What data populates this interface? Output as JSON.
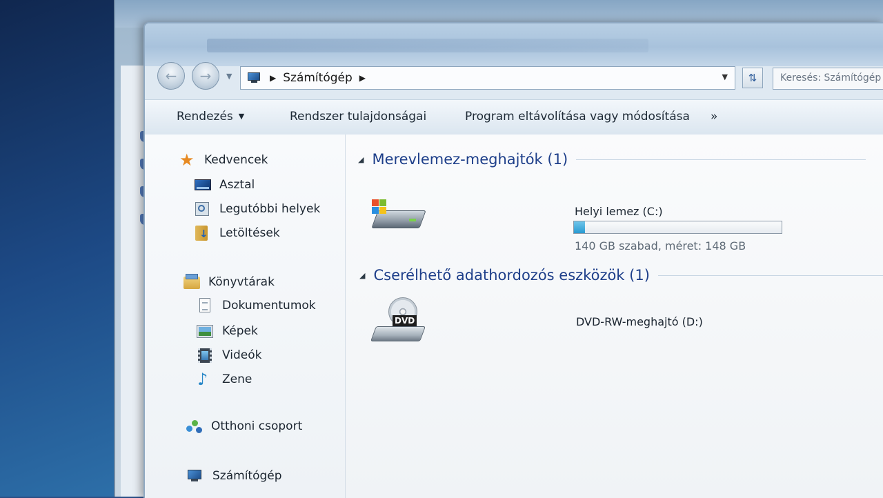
{
  "address": {
    "crumb": "Számítógép",
    "search_placeholder": "Keresés: Számítógép"
  },
  "toolbar": {
    "organize": "Rendezés",
    "system_properties": "Rendszer tulajdonságai",
    "uninstall": "Program eltávolítása vagy módosítása",
    "more": "»"
  },
  "navpane": {
    "favorites": "Kedvencek",
    "desktop": "Asztal",
    "recent": "Legutóbbi helyek",
    "downloads": "Letöltések",
    "libraries": "Könyvtárak",
    "documents": "Dokumentumok",
    "pictures": "Képek",
    "videos": "Videók",
    "music": "Zene",
    "homegroup": "Otthoni csoport",
    "computer": "Számítógép"
  },
  "groups": {
    "hdd_header": "Merevlemez-meghajtók (1)",
    "removable_header": "Cserélhető adathordozós eszközök (1)"
  },
  "drives": {
    "c": {
      "name": "Helyi lemez (C:)",
      "info": "140 GB szabad, méret: 148 GB",
      "used_fraction": 0.054
    },
    "d": {
      "name": "DVD-RW-meghajtó (D:)",
      "badge": "DVD"
    }
  },
  "colors": {
    "group_header": "#1e3f8a",
    "capacity_fill": "#2a9bd2"
  }
}
